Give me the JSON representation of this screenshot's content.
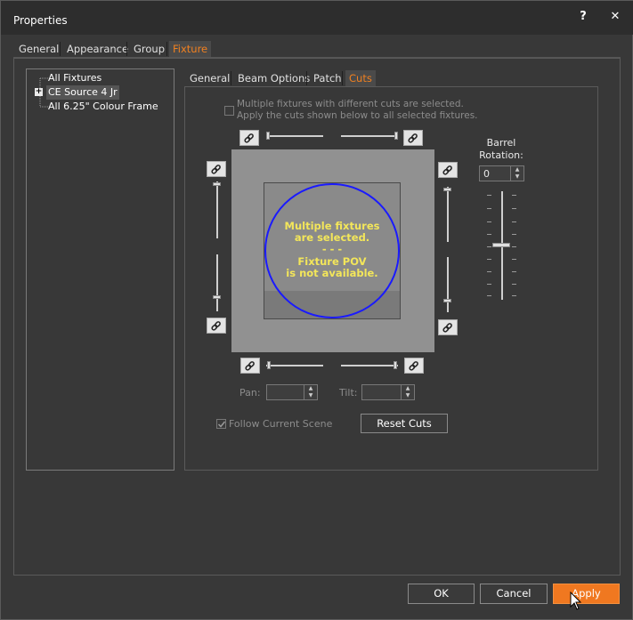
{
  "window": {
    "title": "Properties",
    "help_label": "?",
    "close_label": "✕"
  },
  "tabs": [
    {
      "label": "General"
    },
    {
      "label": "Appearance"
    },
    {
      "label": "Group"
    },
    {
      "label": "Fixture",
      "active": true
    }
  ],
  "tree": {
    "items": [
      {
        "label": "All Fixtures"
      },
      {
        "label": "CE Source 4 Jr",
        "selected": true,
        "expander": "+"
      },
      {
        "label": "All 6.25\" Colour Frame"
      }
    ]
  },
  "inner_tabs": [
    {
      "label": "General"
    },
    {
      "label": "Beam Options"
    },
    {
      "label": "Patch"
    },
    {
      "label": "Cuts",
      "active": true
    }
  ],
  "cuts": {
    "multi_warning_line1": "Multiple fixtures with different cuts are selected.",
    "multi_warning_line2": "Apply the cuts shown below to all selected fixtures.",
    "preview_msg": [
      "Multiple fixtures",
      "are selected.",
      "- - -",
      "Fixture POV",
      "is not available."
    ],
    "barrel_label_line1": "Barrel",
    "barrel_label_line2": "Rotation:",
    "barrel_value": "0",
    "barrel_slider_level": 0.5,
    "pan_label": "Pan:",
    "pan_value": "",
    "tilt_label": "Tilt:",
    "tilt_value": "",
    "follow_scene_label": "Follow Current Scene",
    "follow_scene_checked": true,
    "reset_label": "Reset Cuts"
  },
  "footer": {
    "ok_label": "OK",
    "cancel_label": "Cancel",
    "apply_label": "Apply"
  },
  "colors": {
    "accent": "#f07820",
    "preview_circle": "#1a1aff",
    "preview_text": "#f3e65a"
  }
}
